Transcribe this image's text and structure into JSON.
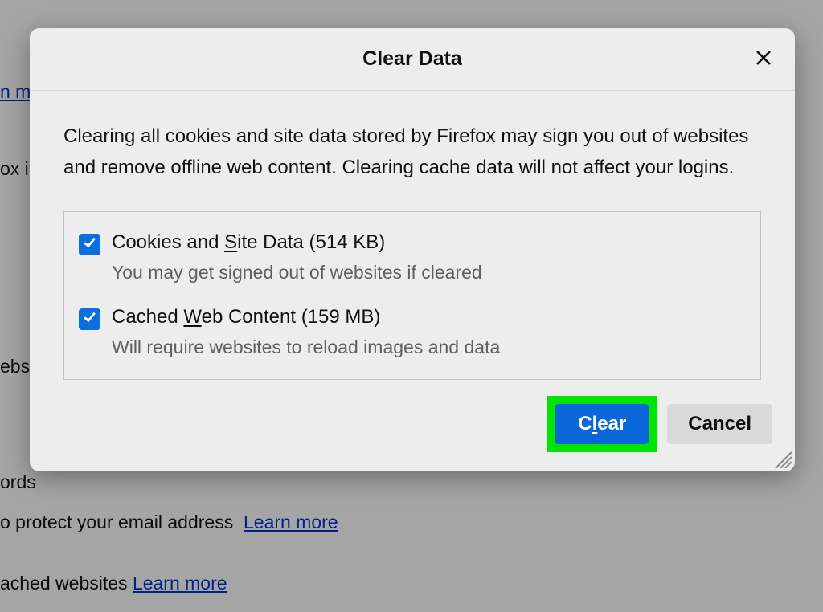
{
  "background": {
    "link1": "n m",
    "text_is": "ox is",
    "ebs": "ebs",
    "ords": "ords",
    "protect_line": "o protect your email address  Learn more",
    "learn_more": "Learn more",
    "cached_line": "ached websites  "
  },
  "dialog": {
    "title": "Clear Data",
    "description": "Clearing all cookies and site data stored by Firefox may sign you out of websites and remove offline web content. Clearing cache data will not affect your logins.",
    "options": [
      {
        "label_pre": "Cookies and ",
        "accesskey": "S",
        "label_post": "ite Data (514 KB)",
        "sublabel": "You may get signed out of websites if cleared",
        "checked": true
      },
      {
        "label_pre": "Cached ",
        "accesskey": "W",
        "label_post": "eb Content (159 MB)",
        "sublabel": "Will require websites to reload images and data",
        "checked": true
      }
    ],
    "buttons": {
      "clear_pre": "C",
      "clear_accesskey": "l",
      "clear_post": "ear",
      "cancel": "Cancel"
    }
  }
}
